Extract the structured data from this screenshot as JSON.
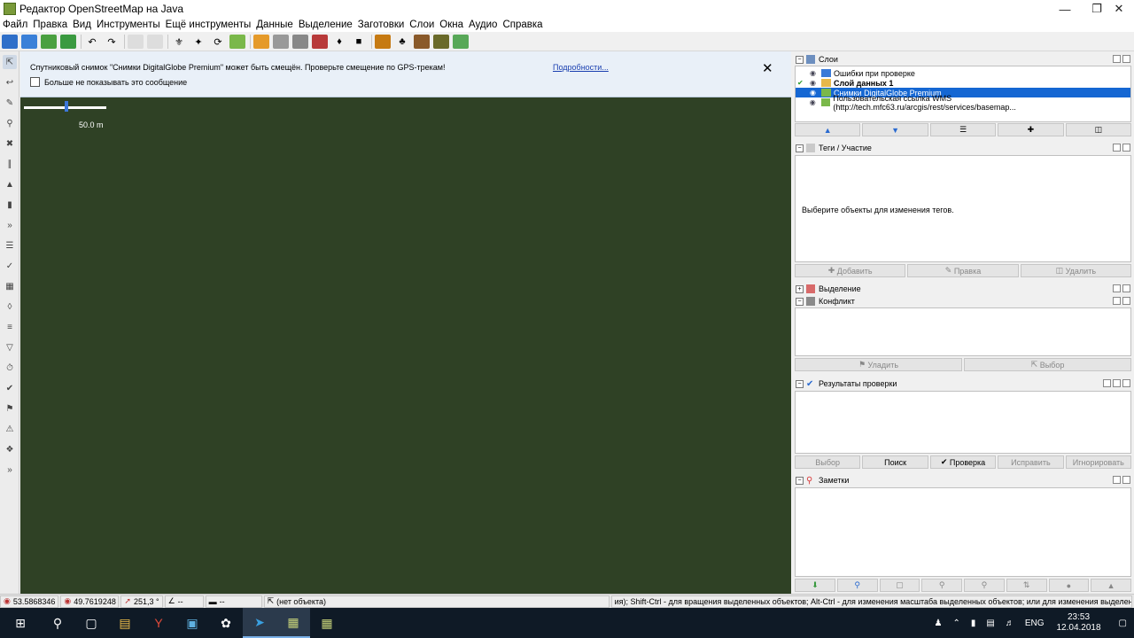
{
  "window": {
    "title": "Редактор OpenStreetMap на Java"
  },
  "menu": [
    "Файл",
    "Правка",
    "Вид",
    "Инструменты",
    "Ещё инструменты",
    "Данные",
    "Выделение",
    "Заготовки",
    "Слои",
    "Окна",
    "Аудио",
    "Справка"
  ],
  "notice": {
    "message": "Спутниковый снимок \"Снимки DigitalGlobe Premium\" может быть смещён. Проверьте смещение по GPS-трекам!",
    "link": "Подробности...",
    "checkbox": "Больше не показывать это сообщение"
  },
  "scale": "50.0 m",
  "layers": {
    "title": "Слои",
    "items": [
      {
        "name": "Ошибки при проверке",
        "selected": false,
        "active": false
      },
      {
        "name": "Слой данных 1",
        "selected": false,
        "active": true
      },
      {
        "name": "Снимки DigitalGlobe Premium",
        "selected": true,
        "active": false
      },
      {
        "name": "Пользовательская ссылка WMS (http://tech.mfc63.ru/arcgis/rest/services/basemap...",
        "selected": false,
        "active": false
      }
    ]
  },
  "tags": {
    "title": "Теги / Участие",
    "empty": "Выберите объекты для изменения тегов.",
    "buttons": [
      "Добавить",
      "Правка",
      "Удалить"
    ]
  },
  "selection": {
    "title": "Выделение"
  },
  "conflict": {
    "title": "Конфликт",
    "buttons": [
      "Уладить",
      "Выбор"
    ]
  },
  "validation": {
    "title": "Результаты проверки",
    "buttons": [
      "Выбор",
      "Поиск",
      "Проверка",
      "Исправить",
      "Игнорировать"
    ]
  },
  "notes": {
    "title": "Заметки"
  },
  "status": {
    "lat": "53.5868346",
    "lon": "49.7619248",
    "heading": "251,3 °",
    "angle": "--",
    "distance": "--",
    "object": "(нет объекта)",
    "hint": "ия); Shift-Ctrl - для вращения выделенных объектов; Alt-Ctrl - для изменения масштаба выделенных объектов; или для изменения выделения"
  },
  "taskbar": {
    "lang": "ENG",
    "time": "23:53",
    "date": "12.04.2018"
  },
  "colors": {
    "selection": "#1567d3",
    "map_bg": "#3a4f2c",
    "road": "#f2e63a",
    "taskbar": "#0f1a26"
  }
}
